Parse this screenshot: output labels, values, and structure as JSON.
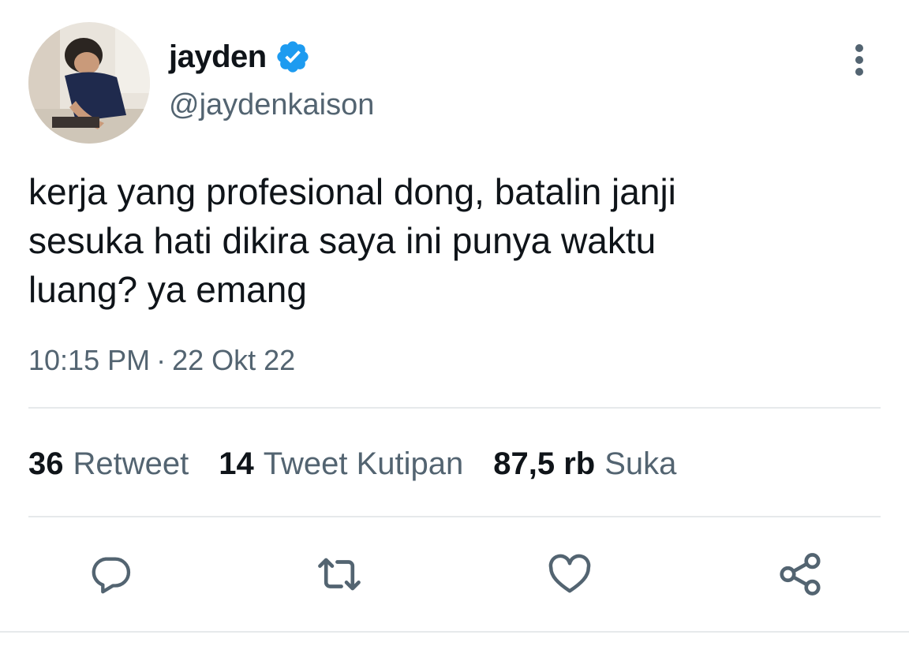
{
  "user": {
    "display_name": "jayden",
    "handle": "@jaydenkaison",
    "verified": true
  },
  "tweet": {
    "text": "kerja yang profesional dong, batalin janji\nsesuka hati dikira saya ini punya waktu\nluang? ya emang",
    "time": "10:15 PM",
    "separator": "·",
    "date": "22 Okt 22"
  },
  "stats": [
    {
      "count": "36",
      "label": "Retweet"
    },
    {
      "count": "14",
      "label": "Tweet Kutipan"
    },
    {
      "count": "87,5 rb",
      "label": "Suka"
    }
  ],
  "actions": [
    {
      "icon": "reply-icon"
    },
    {
      "icon": "retweet-icon"
    },
    {
      "icon": "like-icon"
    },
    {
      "icon": "share-icon"
    }
  ],
  "colors": {
    "text_primary": "#0f1419",
    "text_secondary": "#536471",
    "verified_blue": "#1d9bf0",
    "divider": "#e6e9eb"
  }
}
